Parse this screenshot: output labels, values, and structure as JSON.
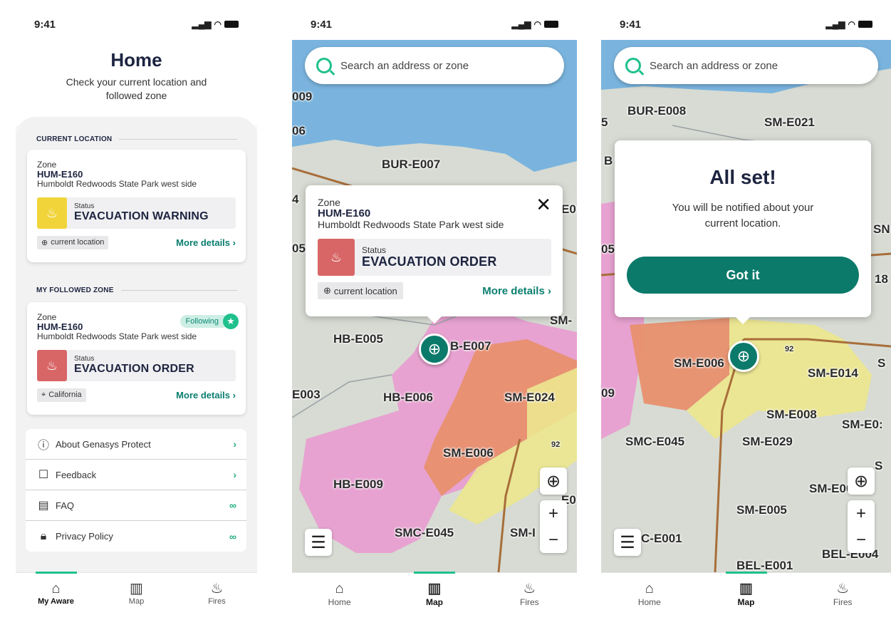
{
  "status_time": "9:41",
  "home": {
    "title": "Home",
    "subtitle": "Check your current location and followed zone",
    "current_section": "CURRENT LOCATION",
    "followed_section": "MY FOLLOWED ZONE",
    "current_card": {
      "zone_label": "Zone",
      "zone_id": "HUM-E160",
      "zone_desc": "Humboldt Redwoods State Park west side",
      "status_label": "Status",
      "status_value": "EVACUATION WARNING",
      "chip": "current location",
      "more": "More details"
    },
    "followed_card": {
      "zone_label": "Zone",
      "zone_id": "HUM-E160",
      "zone_desc": "Humboldt Redwoods State Park west side",
      "following": "Following",
      "status_label": "Status",
      "status_value": "EVACUATION ORDER",
      "chip": "California",
      "more": "More details"
    },
    "menu": [
      {
        "label": "About Genasys Protect",
        "icon": "info-icon"
      },
      {
        "label": "Feedback",
        "icon": "chat-icon"
      },
      {
        "label": "FAQ",
        "icon": "document-icon"
      },
      {
        "label": "Privacy Policy",
        "icon": "lock-icon"
      }
    ],
    "tabs": [
      "My Aware",
      "Map",
      "Fires"
    ]
  },
  "map": {
    "search_placeholder": "Search an address or zone",
    "popup": {
      "zone_label": "Zone",
      "zone_id": "HUM-E160",
      "zone_desc": "Humboldt Redwoods State Park west side",
      "status_label": "Status",
      "status_value": "EVACUATION ORDER",
      "chip": "current location",
      "more": "More details"
    },
    "labels": [
      "009",
      "06",
      "BUR-E007",
      "4",
      "E0:",
      "05",
      "SM-",
      "HB-E005",
      "B-E007",
      "E003",
      "HB-E006",
      "SM-E024",
      "SM-E006",
      "HB-E009",
      "SMC-E045",
      "SM-I",
      "E0",
      "92"
    ],
    "tabs": [
      "Home",
      "Map",
      "Fires"
    ]
  },
  "confirm": {
    "search_placeholder": "Search an address or zone",
    "title": "All set!",
    "message": "You will be notified about your current location.",
    "button": "Got it",
    "labels": [
      "BUR-E008",
      "SM-E021",
      "5",
      "B",
      "SN",
      "05",
      "18",
      "SM-E006",
      "SM-E014",
      "S",
      "09",
      "SM-E008",
      "SM-E0:",
      "SMC-E045",
      "SM-E029",
      "S",
      "SM-E009",
      "SM-E005",
      "C-E001",
      "BEL-E004",
      "BEL-E001",
      "92"
    ],
    "tabs": [
      "Home",
      "Map",
      "Fires"
    ]
  },
  "colors": {
    "accent": "#0b7a6b",
    "accent_light": "#20c08d",
    "warning": "#f1d43a",
    "order": "#d86666",
    "water": "#7ab4de"
  }
}
